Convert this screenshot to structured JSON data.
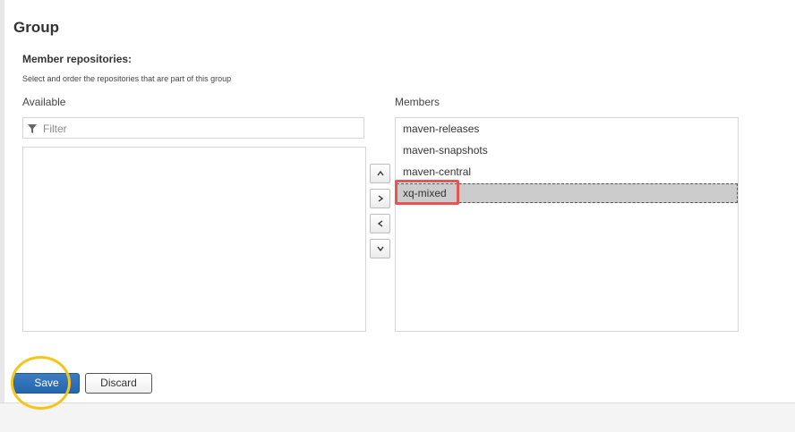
{
  "section": {
    "title": "Group",
    "member_label": "Member repositories:",
    "helper_text": "Select and order the repositories that are part of this group"
  },
  "available": {
    "label": "Available",
    "filter_placeholder": "Filter",
    "items": []
  },
  "members": {
    "label": "Members",
    "items": [
      "maven-releases",
      "maven-snapshots",
      "maven-central",
      "xq-mixed"
    ],
    "selected_index": 3
  },
  "move_buttons": {
    "up_icon": "chevron-up-icon",
    "right_icon": "chevron-right-icon",
    "left_icon": "chevron-left-icon",
    "down_icon": "chevron-down-icon"
  },
  "actions": {
    "save_label": "Save",
    "discard_label": "Discard"
  },
  "colors": {
    "primary": "#2466ab",
    "selected_row": "#cccccc",
    "annotation_red": "#e85353",
    "annotation_yellow": "#f5c518"
  }
}
